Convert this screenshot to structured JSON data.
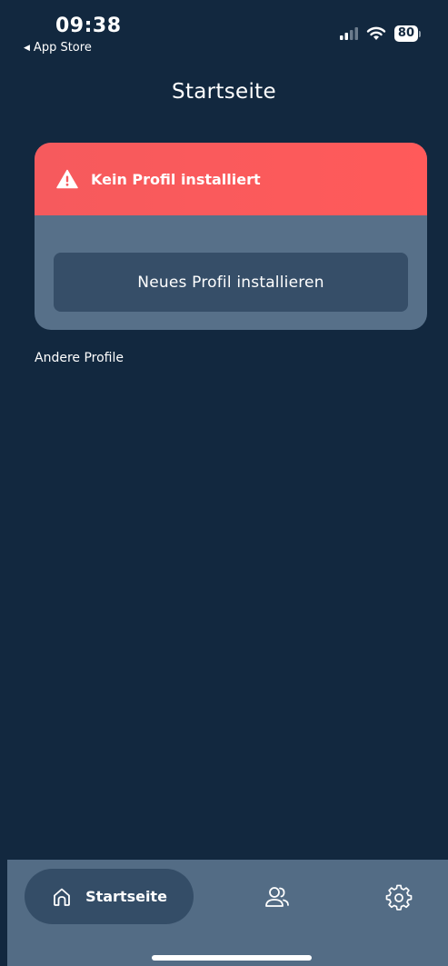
{
  "status_bar": {
    "time": "09:38",
    "back_app": "App Store",
    "battery": "80"
  },
  "header": {
    "title": "Startseite"
  },
  "profile_card": {
    "warning_text": "Kein Profil installiert",
    "install_button_label": "Neues Profil installieren"
  },
  "other_profiles": {
    "label": "Andere Profile"
  },
  "tab_bar": {
    "home_label": "Startseite",
    "items": [
      {
        "icon": "home-icon",
        "label": "Startseite",
        "selected": true
      },
      {
        "icon": "users-icon",
        "selected": false
      },
      {
        "icon": "gear-icon",
        "selected": false
      }
    ]
  },
  "colors": {
    "background": "#12283f",
    "card_body": "#577089",
    "warning": "#ff5a5a",
    "button": "#364e68",
    "tab_bar": "#536c85",
    "tab_selected": "#344d67"
  }
}
